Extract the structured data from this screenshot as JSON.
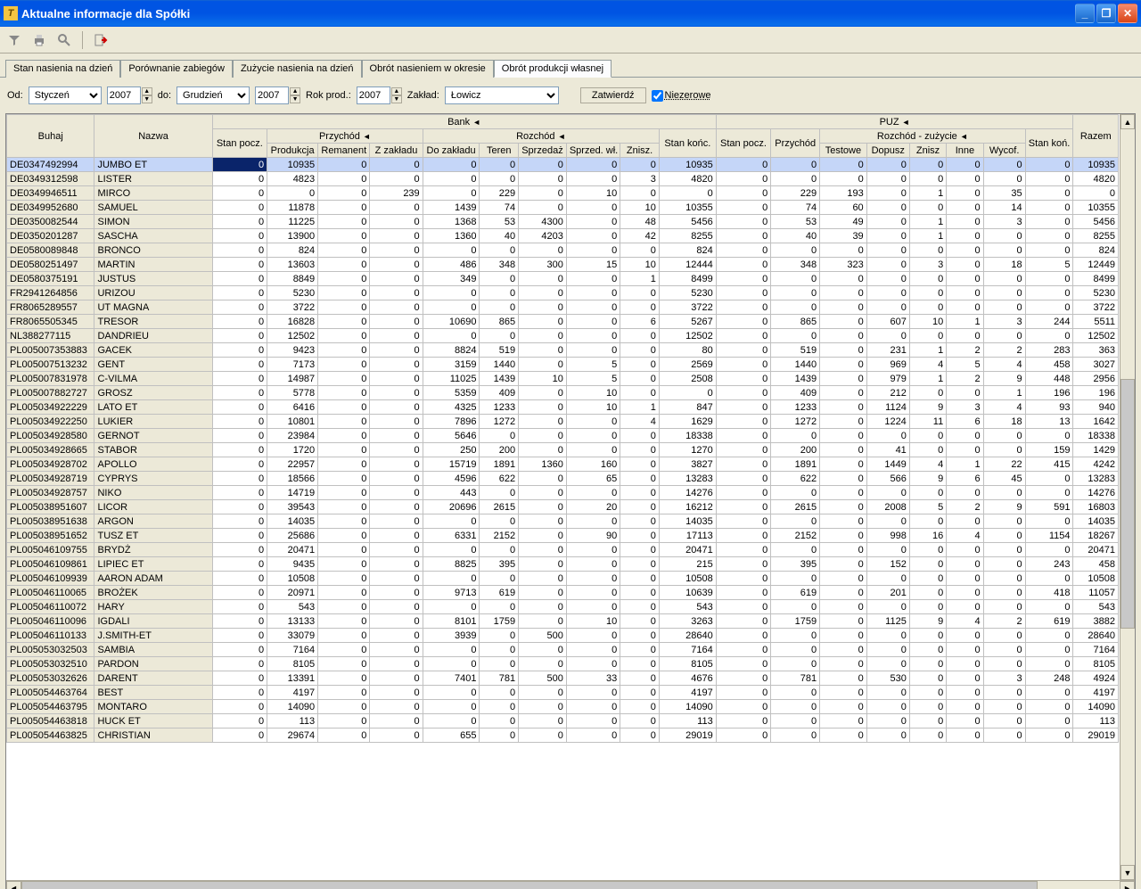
{
  "window": {
    "title": "Aktualne informacje dla Spółki"
  },
  "tabs": [
    {
      "label": "Stan nasienia na dzień"
    },
    {
      "label": "Porównanie zabiegów"
    },
    {
      "label": "Zużycie nasienia na dzień"
    },
    {
      "label": "Obrót nasieniem w okresie"
    },
    {
      "label": "Obrót produkcji własnej"
    }
  ],
  "filter": {
    "od_label": "Od:",
    "od_month": "Styczeń",
    "od_year": "2007",
    "do_label": "do:",
    "do_month": "Grudzień",
    "do_year": "2007",
    "rok_label": "Rok prod.:",
    "rok": "2007",
    "zaklad_label": "Zakład:",
    "zaklad": "Łowicz",
    "apply": "Zatwierdź",
    "niezero": "Niezerowe"
  },
  "headers": {
    "buhaj": "Buhaj",
    "nazwa": "Nazwa",
    "bank": "Bank",
    "puz": "PUZ",
    "razem": "Razem",
    "stanp": "Stan pocz.",
    "przychod": "Przychód",
    "rozchod": "Rozchód",
    "stank": "Stan końc.",
    "przychod2": "Przychód",
    "rozchod2": "Rozchód - zużycie",
    "stank2": "Stan koń.",
    "produkcja": "Produkcja",
    "remanent": "Remanent",
    "zzakladu": "Z zakładu",
    "dozakladu": "Do zakładu",
    "teren": "Teren",
    "sprzedaz": "Sprzedaż",
    "sprzedwl": "Sprzed. wł.",
    "znisz": "Znisz.",
    "testowe": "Testowe",
    "dopusz": "Dopusz",
    "znisz2": "Znisz",
    "inne": "Inne",
    "wycof": "Wycof."
  },
  "rows": [
    {
      "b": "DE0347492994",
      "n": "JUMBO ET",
      "c": [
        0,
        10935,
        0,
        0,
        0,
        0,
        0,
        0,
        0,
        10935,
        0,
        0,
        0,
        0,
        0,
        0,
        0,
        0,
        10935
      ]
    },
    {
      "b": "DE0349312598",
      "n": "LISTER",
      "c": [
        0,
        4823,
        0,
        0,
        0,
        0,
        0,
        0,
        3,
        4820,
        0,
        0,
        0,
        0,
        0,
        0,
        0,
        0,
        4820
      ]
    },
    {
      "b": "DE0349946511",
      "n": "MIRCO",
      "c": [
        0,
        0,
        0,
        239,
        0,
        229,
        0,
        10,
        0,
        0,
        0,
        229,
        193,
        0,
        1,
        0,
        35,
        0,
        0
      ]
    },
    {
      "b": "DE0349952680",
      "n": "SAMUEL",
      "c": [
        0,
        11878,
        0,
        0,
        1439,
        74,
        0,
        0,
        10,
        10355,
        0,
        74,
        60,
        0,
        0,
        0,
        14,
        0,
        10355
      ]
    },
    {
      "b": "DE0350082544",
      "n": "SIMON",
      "c": [
        0,
        11225,
        0,
        0,
        1368,
        53,
        4300,
        0,
        48,
        5456,
        0,
        53,
        49,
        0,
        1,
        0,
        3,
        0,
        5456
      ]
    },
    {
      "b": "DE0350201287",
      "n": "SASCHA",
      "c": [
        0,
        13900,
        0,
        0,
        1360,
        40,
        4203,
        0,
        42,
        8255,
        0,
        40,
        39,
        0,
        1,
        0,
        0,
        0,
        8255
      ]
    },
    {
      "b": "DE0580089848",
      "n": "BRONCO",
      "c": [
        0,
        824,
        0,
        0,
        0,
        0,
        0,
        0,
        0,
        824,
        0,
        0,
        0,
        0,
        0,
        0,
        0,
        0,
        824
      ]
    },
    {
      "b": "DE0580251497",
      "n": "MARTIN",
      "c": [
        0,
        13603,
        0,
        0,
        486,
        348,
        300,
        15,
        10,
        12444,
        0,
        348,
        323,
        0,
        3,
        0,
        18,
        5,
        12449
      ]
    },
    {
      "b": "DE0580375191",
      "n": "JUSTUS",
      "c": [
        0,
        8849,
        0,
        0,
        349,
        0,
        0,
        0,
        1,
        8499,
        0,
        0,
        0,
        0,
        0,
        0,
        0,
        0,
        8499
      ]
    },
    {
      "b": "FR2941264856",
      "n": "URIZOU",
      "c": [
        0,
        5230,
        0,
        0,
        0,
        0,
        0,
        0,
        0,
        5230,
        0,
        0,
        0,
        0,
        0,
        0,
        0,
        0,
        5230
      ]
    },
    {
      "b": "FR8065289557",
      "n": "UT MAGNA",
      "c": [
        0,
        3722,
        0,
        0,
        0,
        0,
        0,
        0,
        0,
        3722,
        0,
        0,
        0,
        0,
        0,
        0,
        0,
        0,
        3722
      ]
    },
    {
      "b": "FR8065505345",
      "n": "TRESOR",
      "c": [
        0,
        16828,
        0,
        0,
        10690,
        865,
        0,
        0,
        6,
        5267,
        0,
        865,
        0,
        607,
        10,
        1,
        3,
        244,
        5511
      ]
    },
    {
      "b": "NL388277115",
      "n": "DANDRIEU",
      "c": [
        0,
        12502,
        0,
        0,
        0,
        0,
        0,
        0,
        0,
        12502,
        0,
        0,
        0,
        0,
        0,
        0,
        0,
        0,
        12502
      ]
    },
    {
      "b": "PL005007353883",
      "n": "GACEK",
      "c": [
        0,
        9423,
        0,
        0,
        8824,
        519,
        0,
        0,
        0,
        80,
        0,
        519,
        0,
        231,
        1,
        2,
        2,
        283,
        363
      ]
    },
    {
      "b": "PL005007513232",
      "n": "GENT",
      "c": [
        0,
        7173,
        0,
        0,
        3159,
        1440,
        0,
        5,
        0,
        2569,
        0,
        1440,
        0,
        969,
        4,
        5,
        4,
        458,
        3027
      ]
    },
    {
      "b": "PL005007831978",
      "n": "C-VILMA",
      "c": [
        0,
        14987,
        0,
        0,
        11025,
        1439,
        10,
        5,
        0,
        2508,
        0,
        1439,
        0,
        979,
        1,
        2,
        9,
        448,
        2956
      ]
    },
    {
      "b": "PL005007882727",
      "n": "GROSZ",
      "c": [
        0,
        5778,
        0,
        0,
        5359,
        409,
        0,
        10,
        0,
        0,
        0,
        409,
        0,
        212,
        0,
        0,
        1,
        196,
        196
      ]
    },
    {
      "b": "PL005034922229",
      "n": "LATO  ET",
      "c": [
        0,
        6416,
        0,
        0,
        4325,
        1233,
        0,
        10,
        1,
        847,
        0,
        1233,
        0,
        1124,
        9,
        3,
        4,
        93,
        940
      ]
    },
    {
      "b": "PL005034922250",
      "n": "LUKIER",
      "c": [
        0,
        10801,
        0,
        0,
        7896,
        1272,
        0,
        0,
        4,
        1629,
        0,
        1272,
        0,
        1224,
        11,
        6,
        18,
        13,
        1642
      ]
    },
    {
      "b": "PL005034928580",
      "n": "GERNOT",
      "c": [
        0,
        23984,
        0,
        0,
        5646,
        0,
        0,
        0,
        0,
        18338,
        0,
        0,
        0,
        0,
        0,
        0,
        0,
        0,
        18338
      ]
    },
    {
      "b": "PL005034928665",
      "n": "STABOR",
      "c": [
        0,
        1720,
        0,
        0,
        250,
        200,
        0,
        0,
        0,
        1270,
        0,
        200,
        0,
        41,
        0,
        0,
        0,
        159,
        1429
      ]
    },
    {
      "b": "PL005034928702",
      "n": "APOLLO",
      "c": [
        0,
        22957,
        0,
        0,
        15719,
        1891,
        1360,
        160,
        0,
        3827,
        0,
        1891,
        0,
        1449,
        4,
        1,
        22,
        415,
        4242
      ]
    },
    {
      "b": "PL005034928719",
      "n": "CYPRYS",
      "c": [
        0,
        18566,
        0,
        0,
        4596,
        622,
        0,
        65,
        0,
        13283,
        0,
        622,
        0,
        566,
        9,
        6,
        45,
        0,
        13283
      ]
    },
    {
      "b": "PL005034928757",
      "n": "NIKO",
      "c": [
        0,
        14719,
        0,
        0,
        443,
        0,
        0,
        0,
        0,
        14276,
        0,
        0,
        0,
        0,
        0,
        0,
        0,
        0,
        14276
      ]
    },
    {
      "b": "PL005038951607",
      "n": "LICOR",
      "c": [
        0,
        39543,
        0,
        0,
        20696,
        2615,
        0,
        20,
        0,
        16212,
        0,
        2615,
        0,
        2008,
        5,
        2,
        9,
        591,
        16803
      ]
    },
    {
      "b": "PL005038951638",
      "n": "ARGON",
      "c": [
        0,
        14035,
        0,
        0,
        0,
        0,
        0,
        0,
        0,
        14035,
        0,
        0,
        0,
        0,
        0,
        0,
        0,
        0,
        14035
      ]
    },
    {
      "b": "PL005038951652",
      "n": "TUSZ ET",
      "c": [
        0,
        25686,
        0,
        0,
        6331,
        2152,
        0,
        90,
        0,
        17113,
        0,
        2152,
        0,
        998,
        16,
        4,
        0,
        1154,
        18267
      ]
    },
    {
      "b": "PL005046109755",
      "n": "BRYDŻ",
      "c": [
        0,
        20471,
        0,
        0,
        0,
        0,
        0,
        0,
        0,
        20471,
        0,
        0,
        0,
        0,
        0,
        0,
        0,
        0,
        20471
      ]
    },
    {
      "b": "PL005046109861",
      "n": "LIPIEC  ET",
      "c": [
        0,
        9435,
        0,
        0,
        8825,
        395,
        0,
        0,
        0,
        215,
        0,
        395,
        0,
        152,
        0,
        0,
        0,
        243,
        458
      ]
    },
    {
      "b": "PL005046109939",
      "n": "AARON ADAM",
      "c": [
        0,
        10508,
        0,
        0,
        0,
        0,
        0,
        0,
        0,
        10508,
        0,
        0,
        0,
        0,
        0,
        0,
        0,
        0,
        10508
      ]
    },
    {
      "b": "PL005046110065",
      "n": "BROŻEK",
      "c": [
        0,
        20971,
        0,
        0,
        9713,
        619,
        0,
        0,
        0,
        10639,
        0,
        619,
        0,
        201,
        0,
        0,
        0,
        418,
        11057
      ]
    },
    {
      "b": "PL005046110072",
      "n": "HARY",
      "c": [
        0,
        543,
        0,
        0,
        0,
        0,
        0,
        0,
        0,
        543,
        0,
        0,
        0,
        0,
        0,
        0,
        0,
        0,
        543
      ]
    },
    {
      "b": "PL005046110096",
      "n": "IGDALI",
      "c": [
        0,
        13133,
        0,
        0,
        8101,
        1759,
        0,
        10,
        0,
        3263,
        0,
        1759,
        0,
        1125,
        9,
        4,
        2,
        619,
        3882
      ]
    },
    {
      "b": "PL005046110133",
      "n": "J.SMITH-ET",
      "c": [
        0,
        33079,
        0,
        0,
        3939,
        0,
        500,
        0,
        0,
        28640,
        0,
        0,
        0,
        0,
        0,
        0,
        0,
        0,
        28640
      ]
    },
    {
      "b": "PL005053032503",
      "n": "SAMBIA",
      "c": [
        0,
        7164,
        0,
        0,
        0,
        0,
        0,
        0,
        0,
        7164,
        0,
        0,
        0,
        0,
        0,
        0,
        0,
        0,
        7164
      ]
    },
    {
      "b": "PL005053032510",
      "n": "PARDON",
      "c": [
        0,
        8105,
        0,
        0,
        0,
        0,
        0,
        0,
        0,
        8105,
        0,
        0,
        0,
        0,
        0,
        0,
        0,
        0,
        8105
      ]
    },
    {
      "b": "PL005053032626",
      "n": "DARENT",
      "c": [
        0,
        13391,
        0,
        0,
        7401,
        781,
        500,
        33,
        0,
        4676,
        0,
        781,
        0,
        530,
        0,
        0,
        3,
        248,
        4924
      ]
    },
    {
      "b": "PL005054463764",
      "n": "BEST",
      "c": [
        0,
        4197,
        0,
        0,
        0,
        0,
        0,
        0,
        0,
        4197,
        0,
        0,
        0,
        0,
        0,
        0,
        0,
        0,
        4197
      ]
    },
    {
      "b": "PL005054463795",
      "n": "MONTARO",
      "c": [
        0,
        14090,
        0,
        0,
        0,
        0,
        0,
        0,
        0,
        14090,
        0,
        0,
        0,
        0,
        0,
        0,
        0,
        0,
        14090
      ]
    },
    {
      "b": "PL005054463818",
      "n": "HUCK ET",
      "c": [
        0,
        113,
        0,
        0,
        0,
        0,
        0,
        0,
        0,
        113,
        0,
        0,
        0,
        0,
        0,
        0,
        0,
        0,
        113
      ]
    },
    {
      "b": "PL005054463825",
      "n": "CHRISTIAN",
      "c": [
        0,
        29674,
        0,
        0,
        655,
        0,
        0,
        0,
        0,
        29019,
        0,
        0,
        0,
        0,
        0,
        0,
        0,
        0,
        29019
      ]
    }
  ]
}
